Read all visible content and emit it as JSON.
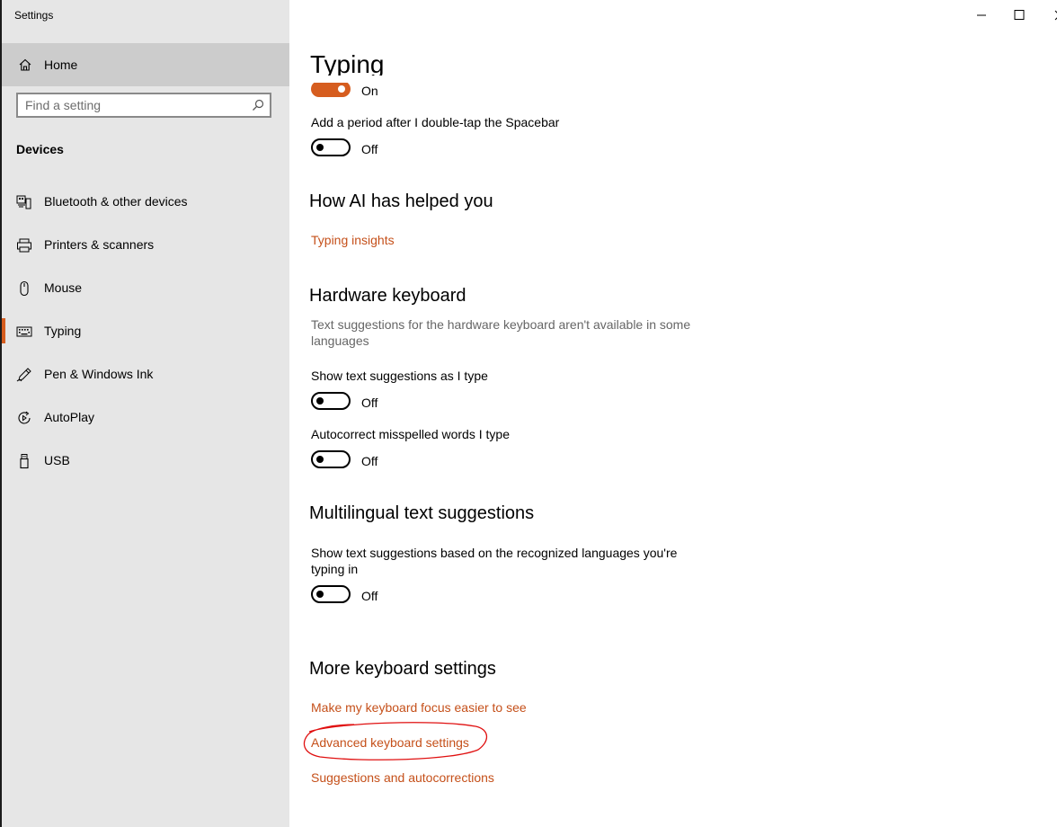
{
  "window": {
    "title": "Settings",
    "controls": {
      "minimize": "minimize-icon",
      "maximize": "maximize-icon",
      "close": "close-icon"
    }
  },
  "sidebar": {
    "home_label": "Home",
    "search": {
      "placeholder": "Find a setting",
      "value": ""
    },
    "section": "Devices",
    "items": [
      {
        "label": "Bluetooth & other devices",
        "icon": "bluetooth-devices-icon"
      },
      {
        "label": "Printers & scanners",
        "icon": "printer-icon"
      },
      {
        "label": "Mouse",
        "icon": "mouse-icon"
      },
      {
        "label": "Typing",
        "icon": "keyboard-icon",
        "active": true
      },
      {
        "label": "Pen & Windows Ink",
        "icon": "pen-icon"
      },
      {
        "label": "AutoPlay",
        "icon": "autoplay-icon"
      },
      {
        "label": "USB",
        "icon": "usb-icon"
      }
    ]
  },
  "main": {
    "title": "Typing",
    "top_toggle_state": "On",
    "period_setting": {
      "label": "Add a period after I double-tap the Spacebar",
      "state": "Off"
    },
    "ai_section": {
      "heading": "How AI has helped you",
      "link": "Typing insights"
    },
    "hardware_section": {
      "heading": "Hardware keyboard",
      "description": "Text suggestions for the hardware keyboard aren't available in some languages",
      "suggestions": {
        "label": "Show text suggestions as I type",
        "state": "Off"
      },
      "autocorrect": {
        "label": "Autocorrect misspelled words I type",
        "state": "Off"
      }
    },
    "multilingual_section": {
      "heading": "Multilingual text suggestions",
      "label": "Show text suggestions based on the recognized languages you're typing in",
      "state": "Off"
    },
    "more_section": {
      "heading": "More keyboard settings",
      "links": [
        "Make my keyboard focus easier to see",
        "Advanced keyboard settings",
        "Suggestions and autocorrections"
      ]
    }
  },
  "colors": {
    "accent": "#d65d1f",
    "link": "#c5501a",
    "annotation": "#e01010",
    "sidebar_bg": "#e6e6e6"
  }
}
